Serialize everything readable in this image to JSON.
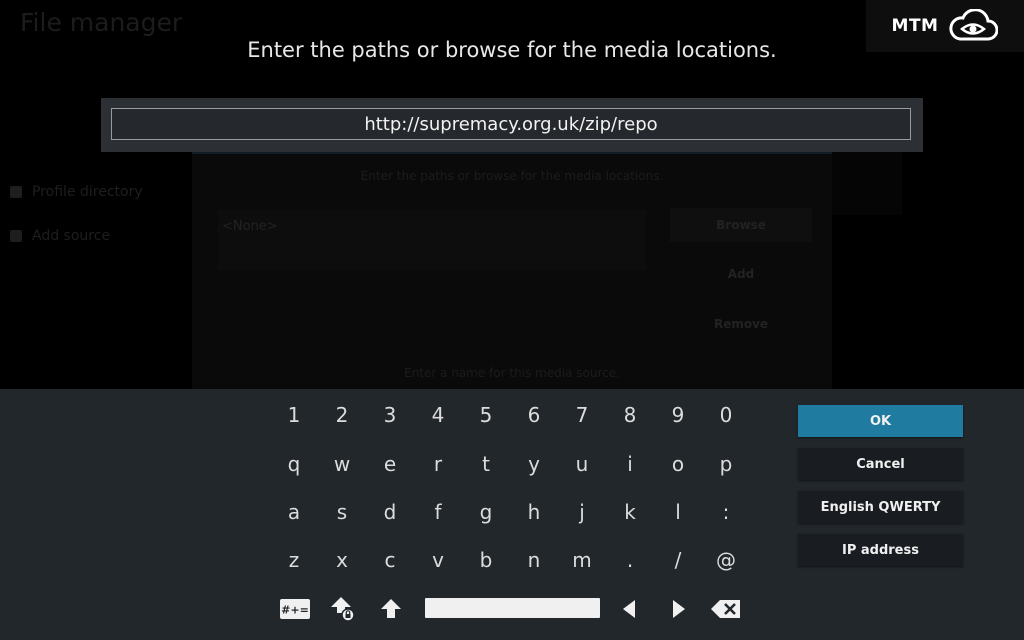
{
  "background": {
    "title": "File manager",
    "sidebar": [
      "Profile directory",
      "Add source"
    ],
    "dialog_hint": "Enter the paths or browse for the media locations.",
    "none_label": "<None>",
    "browse": "Browse",
    "add": "Add",
    "remove": "Remove",
    "name_hint": "Enter a name for this media source."
  },
  "heading": "Enter the paths or browse for the media locations.",
  "brand": {
    "text": "MTM",
    "icon": "cloud-eye-icon"
  },
  "input": {
    "value": "http://supremacy.org.uk/zip/repo"
  },
  "keyboard": {
    "rows": [
      [
        "1",
        "2",
        "3",
        "4",
        "5",
        "6",
        "7",
        "8",
        "9",
        "0"
      ],
      [
        "q",
        "w",
        "e",
        "r",
        "t",
        "y",
        "u",
        "i",
        "o",
        "p"
      ],
      [
        "a",
        "s",
        "d",
        "f",
        "g",
        "h",
        "j",
        "k",
        "l",
        ":"
      ],
      [
        "z",
        "x",
        "c",
        "v",
        "b",
        "n",
        "m",
        ".",
        "/",
        "@"
      ]
    ],
    "symbols_label": "#+=",
    "controls": [
      "symbols-icon",
      "caps-lock-icon",
      "shift-icon",
      "space-bar",
      "left-arrow-icon",
      "right-arrow-icon",
      "backspace-icon"
    ]
  },
  "buttons": {
    "ok": "OK",
    "cancel": "Cancel",
    "layout": "English QWERTY",
    "ip": "IP address"
  },
  "colors": {
    "accent": "#1f7ca0",
    "keyboard_bg": "#22272b",
    "input_bg": "#2c2f33"
  }
}
